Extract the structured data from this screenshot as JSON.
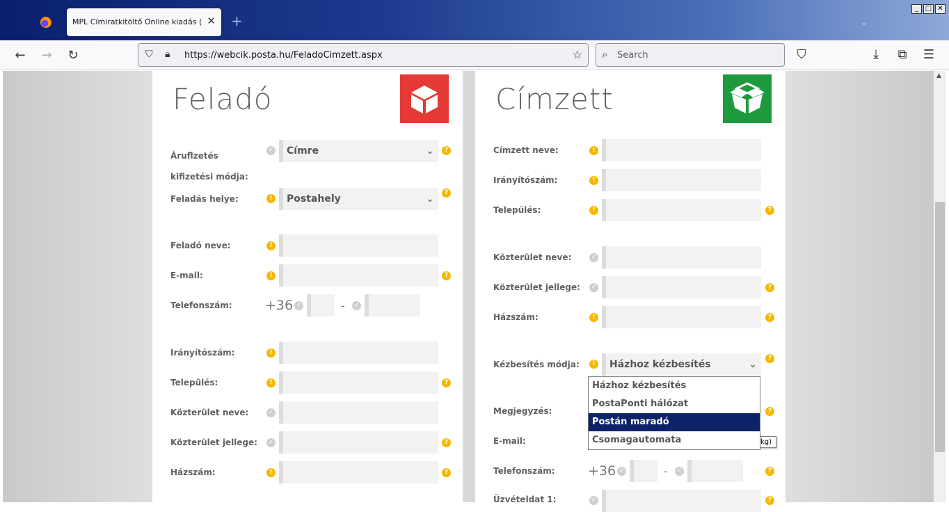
{
  "browser": {
    "tab_title": "MPL Címiratkitöltő Online kiadás (Webcík)",
    "url": "https://webcik.posta.hu/FeladoCimzett.aspx",
    "search_placeholder": "Search"
  },
  "felado": {
    "heading": "Feladó",
    "fields": {
      "payment_label": "Áruflzetés kifizetési módja:",
      "payment_value": "Címre",
      "place_label": "Feladás helye:",
      "place_value": "Postahely",
      "name_label": "Feladó neve:",
      "email_label": "E-mail:",
      "phone_label": "Telefonszám:",
      "phone_prefix": "+36",
      "phone_sep": "-",
      "zip_label": "Irányítószám:",
      "city_label": "Település:",
      "street_label": "Közterület neve:",
      "street_type_label": "Közterület jellege:",
      "house_label": "Házszám:"
    }
  },
  "cimzett": {
    "heading": "Címzett",
    "fields": {
      "name_label": "Címzett neve:",
      "zip_label": "Irányítószám:",
      "city_label": "Település:",
      "street_label": "Közterület neve:",
      "street_type_label": "Közterület jellege:",
      "house_label": "Házszám:",
      "delivery_label": "Kézbesítés módja:",
      "delivery_value": "Házhoz kézbesítés",
      "note_label": "Megjegyzés:",
      "email_label": "E-mail:",
      "phone_label": "Telefonszám:",
      "phone_prefix": "+36",
      "phone_sep": "-",
      "service_label": "Üzvételdat 1:"
    }
  },
  "dropdown": {
    "options": [
      "Házhoz kézbesítés",
      "PostaPonti hálózat",
      "Postán maradó",
      "Csomagautomata"
    ],
    "highlighted": "Postán maradó"
  },
  "tooltip_text": "kg)",
  "icons": {
    "felado_color": "#e53935",
    "cimzett_color": "#1e9a3e",
    "warn_color": "#f5b800"
  }
}
